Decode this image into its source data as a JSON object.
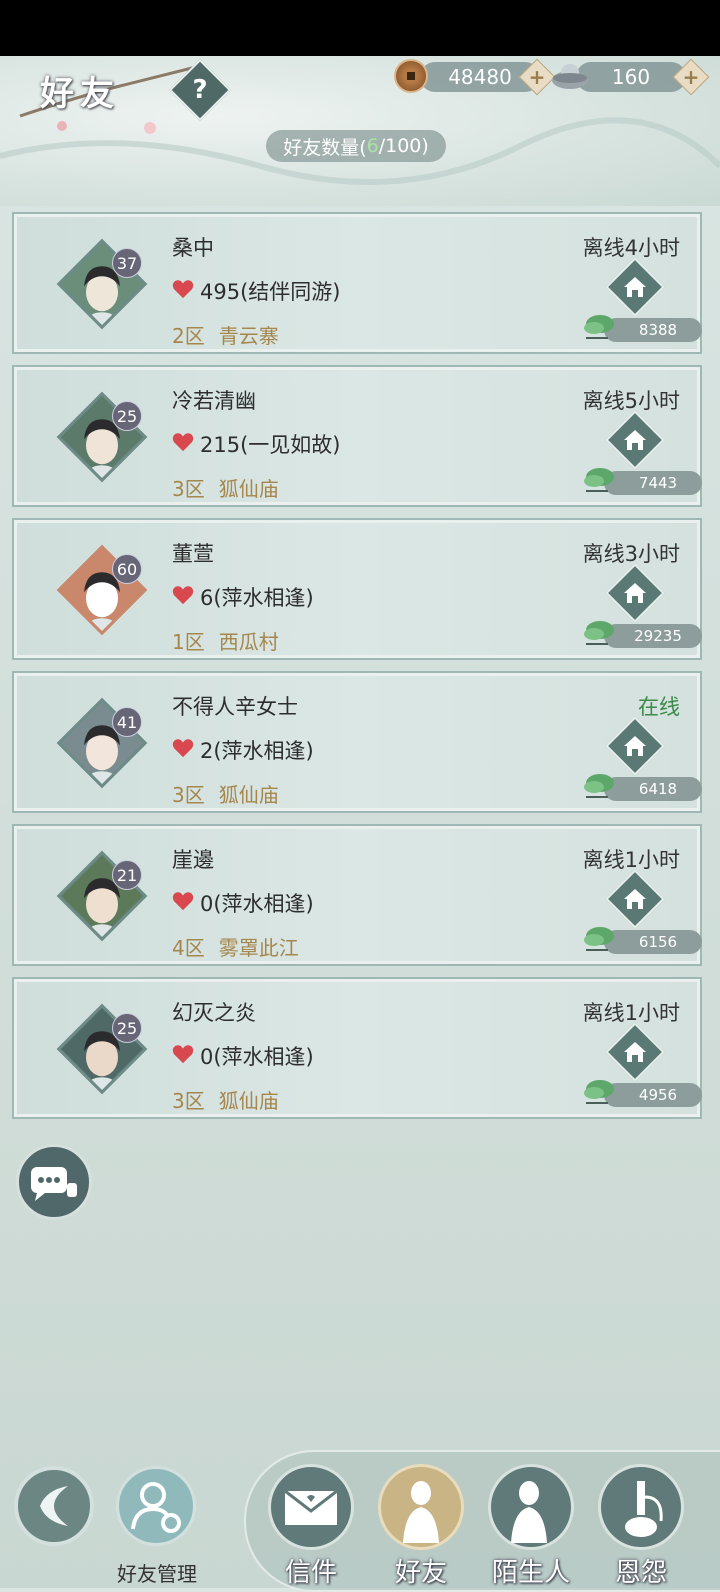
{
  "header": {
    "title": "好友",
    "help_glyph": "?",
    "copper_amount": "48480",
    "ingot_amount": "160",
    "plus_glyph": "+",
    "friend_count_prefix": "好友数量(",
    "friend_count_current": "6",
    "friend_count_suffix": "/100)"
  },
  "friends": [
    {
      "name": "桑中",
      "level": "37",
      "intimacy": "495(结伴同游)",
      "zone": "2区",
      "place": "青云寨",
      "status": "离线4小时",
      "gift": "8388"
    },
    {
      "name": "冷若清幽",
      "level": "25",
      "intimacy": "215(一见如故)",
      "zone": "3区",
      "place": "狐仙庙",
      "status": "离线5小时",
      "gift": "7443"
    },
    {
      "name": "董萱",
      "level": "60",
      "intimacy": "6(萍水相逢)",
      "zone": "1区",
      "place": "西瓜村",
      "status": "离线3小时",
      "gift": "29235"
    },
    {
      "name": "不得人辛女士",
      "level": "41",
      "intimacy": "2(萍水相逢)",
      "zone": "3区",
      "place": "狐仙庙",
      "status": "在线",
      "gift": "6418"
    },
    {
      "name": "崖邊",
      "level": "21",
      "intimacy": "0(萍水相逢)",
      "zone": "4区",
      "place": "雾罩此江",
      "status": "离线1小时",
      "gift": "6156"
    },
    {
      "name": "幻灭之炎",
      "level": "25",
      "intimacy": "0(萍水相逢)",
      "zone": "3区",
      "place": "狐仙庙",
      "status": "离线1小时",
      "gift": "4956"
    }
  ],
  "bottom": {
    "manage_label": "好友管理",
    "tabs": [
      "信件",
      "好友",
      "陌生人",
      "恩怨"
    ],
    "active_tab": "好友"
  },
  "colors": {
    "online": "#3b8a4a",
    "location": "#a5874e",
    "heart": "#d9474f"
  }
}
